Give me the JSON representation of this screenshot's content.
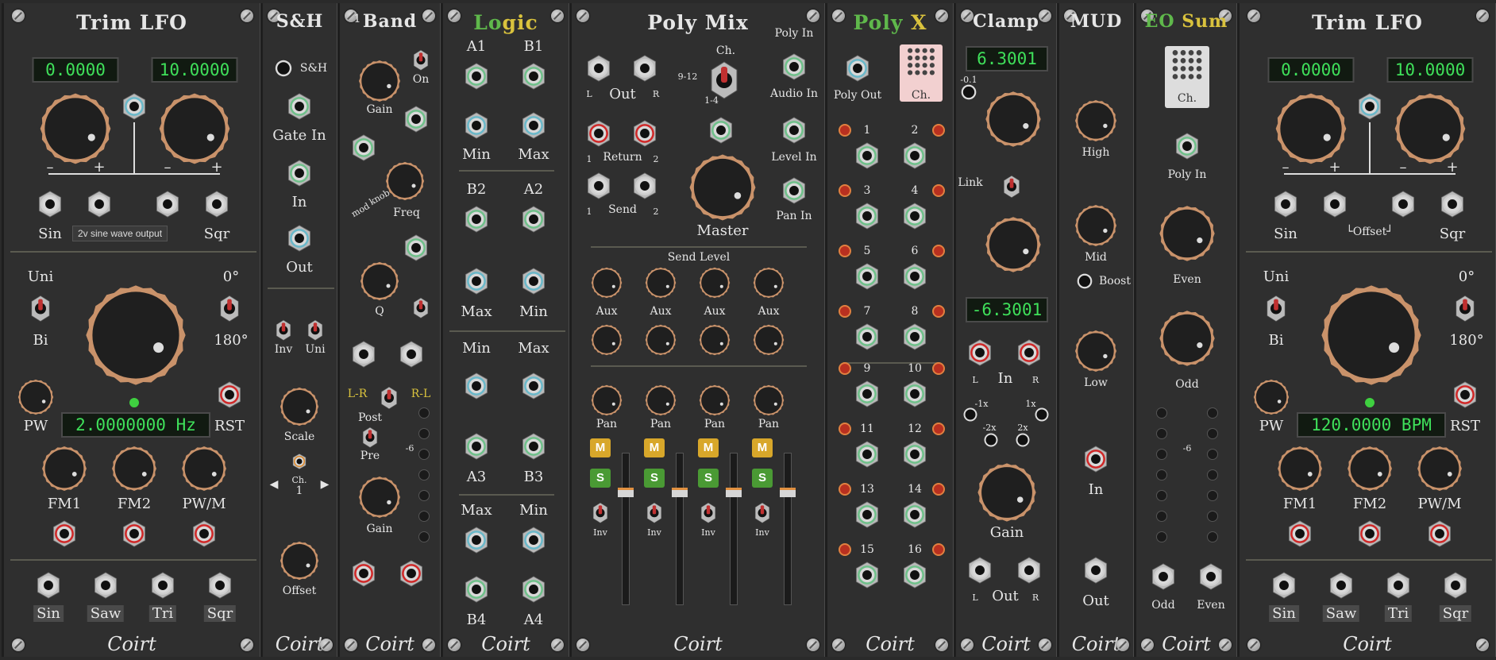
{
  "brand": "Coirt",
  "trim_lfo_1": {
    "title": "Trim  LFO",
    "display_low": "0.0000",
    "display_high": "10.0000",
    "jack_labels": [
      "Sin",
      "Sqr"
    ],
    "tooltip": "2v sine wave output",
    "switch_top": "Uni",
    "switch_bottom": "Bi",
    "phase_top": "0°",
    "phase_bottom": "180°",
    "pw": "PW",
    "rst": "RST",
    "freq_display": "2.0000000  Hz",
    "mod_labels": [
      "FM1",
      "FM2",
      "PW/M"
    ],
    "out_labels": [
      "Sin",
      "Saw",
      "Tri",
      "Sqr"
    ]
  },
  "sh": {
    "title": "S&H",
    "sh_label": "S&H",
    "gate": "Gate In",
    "in": "In",
    "out": "Out",
    "inv": "Inv",
    "uni": "Uni",
    "scale": "Scale",
    "ch_label": "Ch.",
    "ch_value": "1",
    "offset": "Offset"
  },
  "band": {
    "title": "Band",
    "num": "1",
    "on": "On",
    "gain": "Gain",
    "knob": "knob",
    "mod": "mod",
    "freq": "Freq",
    "q": "Q",
    "lr": "L-R",
    "rl": "R-L",
    "post": "Post",
    "pre": "Pre",
    "minus6": "-6",
    "gain2": "Gain"
  },
  "logic": {
    "title_a": "Lo",
    "title_b": "gic",
    "row1": [
      "A1",
      "B1"
    ],
    "row2": [
      "Min",
      "Max"
    ],
    "row3": [
      "B2",
      "A2"
    ],
    "row4": [
      "Max",
      "Min"
    ],
    "row5": [
      "Min",
      "Max"
    ],
    "row6": [
      "A3",
      "B3"
    ],
    "row7": [
      "Max",
      "Min"
    ],
    "row8": [
      "B4",
      "A4"
    ]
  },
  "poly_mix": {
    "title": "Poly  Mix",
    "out": "Out",
    "l": "L",
    "r": "R",
    "ch": "Ch.",
    "ch_range": "9-12",
    "ch_range2": "1-4",
    "poly_in": "Poly In",
    "audio_in": "Audio In",
    "return": "Return",
    "send": "Send",
    "master": "Master",
    "level_in": "Level In",
    "pan_in": "Pan In",
    "send_level": "Send  Level",
    "aux": "Aux",
    "pan": "Pan",
    "m": "M",
    "s": "S",
    "inv": "Inv",
    "one": "1",
    "two": "2"
  },
  "poly_x": {
    "title_a": "Poly",
    "title_b": "X",
    "poly_out": "Poly Out",
    "ch": "Ch.",
    "nums": [
      "1",
      "2",
      "3",
      "4",
      "5",
      "6",
      "7",
      "8",
      "9",
      "10",
      "11",
      "12",
      "13",
      "14",
      "15",
      "16"
    ]
  },
  "clamp": {
    "title": "Clamp",
    "display_high": "6.3001",
    "display_low": "-6.3001",
    "neg01": "-0.1",
    "link": "Link",
    "in": "In",
    "l": "L",
    "r": "R",
    "gain": "Gain",
    "out": "Out",
    "m1x": "-1x",
    "p1x": "1x",
    "m2x": "-2x",
    "p2x": "2x"
  },
  "mud": {
    "title": "MUD",
    "high": "High",
    "mid": "Mid",
    "boost": "Boost",
    "low": "Low",
    "in": "In",
    "out": "Out"
  },
  "eo_sum": {
    "title_a": "EO",
    "title_b": "Sum",
    "ch": "Ch.",
    "poly_in": "Poly In",
    "even": "Even",
    "odd": "Odd",
    "minus6": "-6",
    "odd2": "Odd",
    "even2": "Even"
  },
  "trim_lfo_2": {
    "title": "Trim  LFO",
    "display_low": "0.0000",
    "display_high": "10.0000",
    "jack_labels": [
      "Sin",
      "Sqr"
    ],
    "offset": "└Offset┘",
    "switch_top": "Uni",
    "switch_bottom": "Bi",
    "phase_top": "0°",
    "phase_bottom": "180°",
    "pw": "PW",
    "rst": "RST",
    "freq_display": "120.0000 BPM",
    "mod_labels": [
      "FM1",
      "FM2",
      "PW/M"
    ],
    "out_labels": [
      "Sin",
      "Saw",
      "Tri",
      "Sqr"
    ]
  },
  "colors": {
    "accent_green": "#5fb84b",
    "accent_yellow": "#d9c23d",
    "lcd_green": "#3fe05a",
    "jack_red": "#d02828",
    "jack_teal": "#6ab8c9",
    "jack_green": "#6fc08a",
    "knob_ring": "#c9926a"
  }
}
